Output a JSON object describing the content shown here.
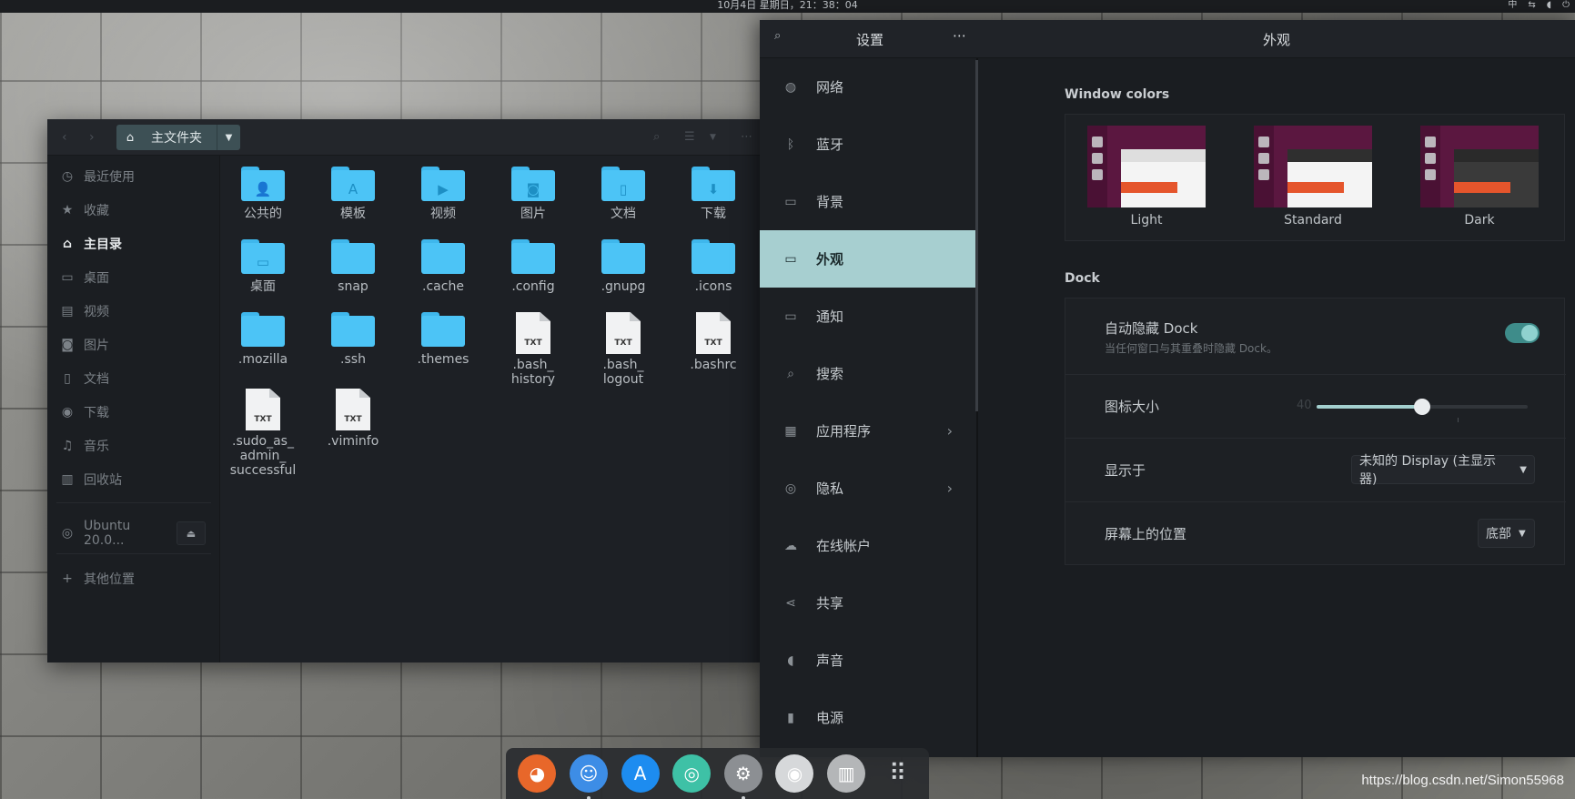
{
  "topbar": {
    "clock": "10月4日 星期日，21：38：04",
    "input_method": "中",
    "tray_icons": [
      "network-icon",
      "volume-icon",
      "power-icon"
    ]
  },
  "files": {
    "path_label": "主文件夹",
    "sidebar": [
      {
        "label": "最近使用",
        "icon": "recent-icon",
        "glyph": "◷"
      },
      {
        "label": "收藏",
        "icon": "star-icon",
        "glyph": "★"
      },
      {
        "label": "主目录",
        "icon": "home-icon",
        "glyph": "⌂",
        "active": true
      },
      {
        "label": "桌面",
        "icon": "desktop-icon",
        "glyph": "▭"
      },
      {
        "label": "视频",
        "icon": "video-icon",
        "glyph": "▤"
      },
      {
        "label": "图片",
        "icon": "camera-icon",
        "glyph": "◙"
      },
      {
        "label": "文档",
        "icon": "document-icon",
        "glyph": "▯"
      },
      {
        "label": "下载",
        "icon": "download-icon",
        "glyph": "◉"
      },
      {
        "label": "音乐",
        "icon": "music-icon",
        "glyph": "♫"
      },
      {
        "label": "回收站",
        "icon": "trash-icon",
        "glyph": "▥"
      }
    ],
    "drive_label": "Ubuntu 20.0...",
    "other_locations": "其他位置",
    "items": [
      {
        "name": "公共的",
        "kind": "folder",
        "glyph": "👤"
      },
      {
        "name": "模板",
        "kind": "folder",
        "glyph": "A"
      },
      {
        "name": "视频",
        "kind": "folder",
        "glyph": "▶"
      },
      {
        "name": "图片",
        "kind": "folder",
        "glyph": "◙"
      },
      {
        "name": "文档",
        "kind": "folder",
        "glyph": "▯"
      },
      {
        "name": "下载",
        "kind": "folder",
        "glyph": "⬇"
      },
      {
        "name": "桌面",
        "kind": "folder",
        "glyph": "▭"
      },
      {
        "name": "snap",
        "kind": "folder",
        "glyph": ""
      },
      {
        "name": ".cache",
        "kind": "folder",
        "glyph": ""
      },
      {
        "name": ".config",
        "kind": "folder",
        "glyph": ""
      },
      {
        "name": ".gnupg",
        "kind": "folder",
        "glyph": ""
      },
      {
        "name": ".icons",
        "kind": "folder",
        "glyph": ""
      },
      {
        "name": ".mozilla",
        "kind": "folder",
        "glyph": ""
      },
      {
        "name": ".ssh",
        "kind": "folder",
        "glyph": ""
      },
      {
        "name": ".themes",
        "kind": "folder",
        "glyph": ""
      },
      {
        "name": ".bash_\nhistory",
        "kind": "txt",
        "glyph": "TXT"
      },
      {
        "name": ".bash_\nlogout",
        "kind": "txt",
        "glyph": "TXT"
      },
      {
        "name": ".bashrc",
        "kind": "txt",
        "glyph": "TXT"
      },
      {
        "name": ".sudo_as_\nadmin_\nsuccessful",
        "kind": "txt",
        "glyph": "TXT"
      },
      {
        "name": ".viminfo",
        "kind": "txt",
        "glyph": "TXT"
      }
    ]
  },
  "settings": {
    "title": "设置",
    "page_title": "外观",
    "nav": [
      {
        "label": "网络",
        "icon": "network-icon",
        "glyph": "◍"
      },
      {
        "label": "蓝牙",
        "icon": "bluetooth-icon",
        "glyph": "ᛒ"
      },
      {
        "label": "背景",
        "icon": "background-icon",
        "glyph": "▭"
      },
      {
        "label": "外观",
        "icon": "appearance-icon",
        "glyph": "▭",
        "active": true
      },
      {
        "label": "通知",
        "icon": "notification-icon",
        "glyph": "▭"
      },
      {
        "label": "搜索",
        "icon": "search-icon",
        "glyph": "⌕"
      },
      {
        "label": "应用程序",
        "icon": "apps-icon",
        "glyph": "▦",
        "chevron": true
      },
      {
        "label": "隐私",
        "icon": "privacy-icon",
        "glyph": "◎",
        "chevron": true
      },
      {
        "label": "在线帐户",
        "icon": "cloud-icon",
        "glyph": "☁"
      },
      {
        "label": "共享",
        "icon": "share-icon",
        "glyph": "⋖"
      },
      {
        "label": "声音",
        "icon": "sound-icon",
        "glyph": "◖"
      },
      {
        "label": "电源",
        "icon": "power-icon",
        "glyph": "▮"
      }
    ],
    "window_colors_title": "Window colors",
    "themes": [
      {
        "label": "Light",
        "variant": "light"
      },
      {
        "label": "Standard",
        "variant": "standard"
      },
      {
        "label": "Dark",
        "variant": "dark"
      }
    ],
    "dock_title": "Dock",
    "autohide": {
      "label": "自动隐藏 Dock",
      "sub": "当任何窗口与其重叠时隐藏 Dock。",
      "on": true
    },
    "icon_size": {
      "label": "图标大小",
      "value_label": "40",
      "fraction": 0.5
    },
    "show_on": {
      "label": "显示于",
      "value": "未知的 Display (主显示器)"
    },
    "position": {
      "label": "屏幕上的位置",
      "value": "底部"
    }
  },
  "dock": [
    {
      "name": "firefox",
      "glyph": "◕",
      "color": "#e8672a"
    },
    {
      "name": "finder",
      "glyph": "☺",
      "color": "#3d8de6",
      "running": true
    },
    {
      "name": "app-store",
      "glyph": "A",
      "color": "#1d8cf0"
    },
    {
      "name": "screenshot",
      "glyph": "◎",
      "color": "#3ec1a6"
    },
    {
      "name": "settings",
      "glyph": "⚙",
      "color": "#8c8f93",
      "running": true
    },
    {
      "name": "dvd",
      "glyph": "◉",
      "color": "#d6d8da"
    },
    {
      "name": "trash",
      "glyph": "▥",
      "color": "#b4b6b8"
    },
    {
      "name": "show-apps",
      "glyph": "⠿",
      "color": "transparent"
    }
  ],
  "watermark": "https://blog.csdn.net/Simon55968"
}
